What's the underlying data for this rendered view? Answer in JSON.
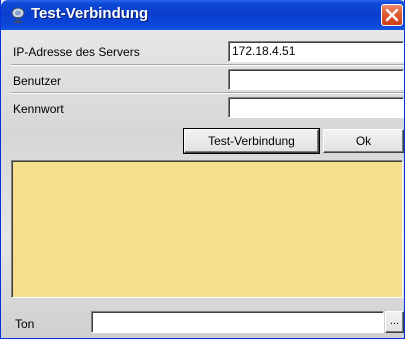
{
  "window": {
    "title": "Test-Verbindung",
    "close_icon": "close-icon",
    "app_icon": "satellite-dish-icon"
  },
  "form": {
    "server_ip_label": "IP-Adresse des Servers",
    "server_ip_value": "172.18.4.51",
    "user_label": "Benutzer",
    "user_value": "",
    "password_label": "Kennwort",
    "password_value": ""
  },
  "buttons": {
    "test_connection": "Test-Verbindung",
    "ok": "Ok",
    "browse": "..."
  },
  "log": {
    "text": "",
    "background": "#f4e08c"
  },
  "sound": {
    "label": "Ton",
    "value": ""
  }
}
